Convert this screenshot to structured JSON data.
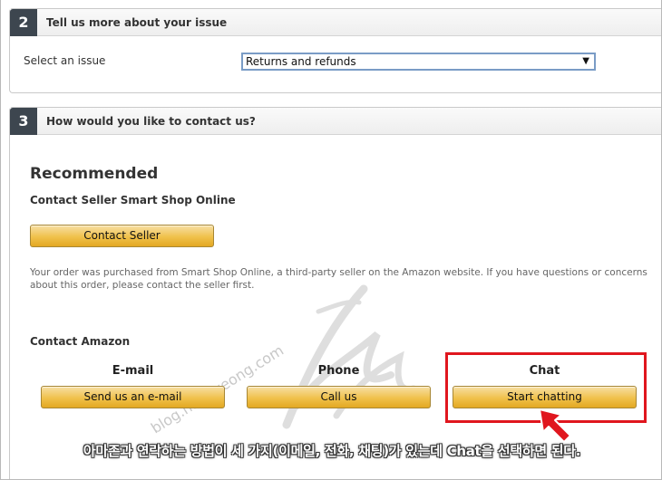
{
  "section2": {
    "step": "2",
    "title": "Tell us more about your issue",
    "issue_label": "Select an issue",
    "issue_selected": "Returns and refunds"
  },
  "section3": {
    "step": "3",
    "title": "How would you like to contact us?",
    "recommended_heading": "Recommended",
    "seller_title": "Contact Seller Smart Shop Online",
    "contact_seller_button": "Contact Seller",
    "info_text": "Your order was purchased from Smart Shop Online, a third-party seller on the Amazon website. If you have questions or concerns about this order, please contact the seller first.",
    "contact_amazon_heading": "Contact Amazon",
    "options": {
      "email": {
        "heading": "E-mail",
        "button": "Send us an e-mail"
      },
      "phone": {
        "heading": "Phone",
        "button": "Call us"
      },
      "chat": {
        "heading": "Chat",
        "button": "Start chatting"
      }
    }
  },
  "annotation": {
    "caption": "아마존과 연락하는 방법이 세 가지(이메일, 전화, 채팅)가 있는데  Chat을 선택하면 된다.",
    "watermark": "blog.hangyeong.com",
    "highlight_color": "#e0161e"
  }
}
